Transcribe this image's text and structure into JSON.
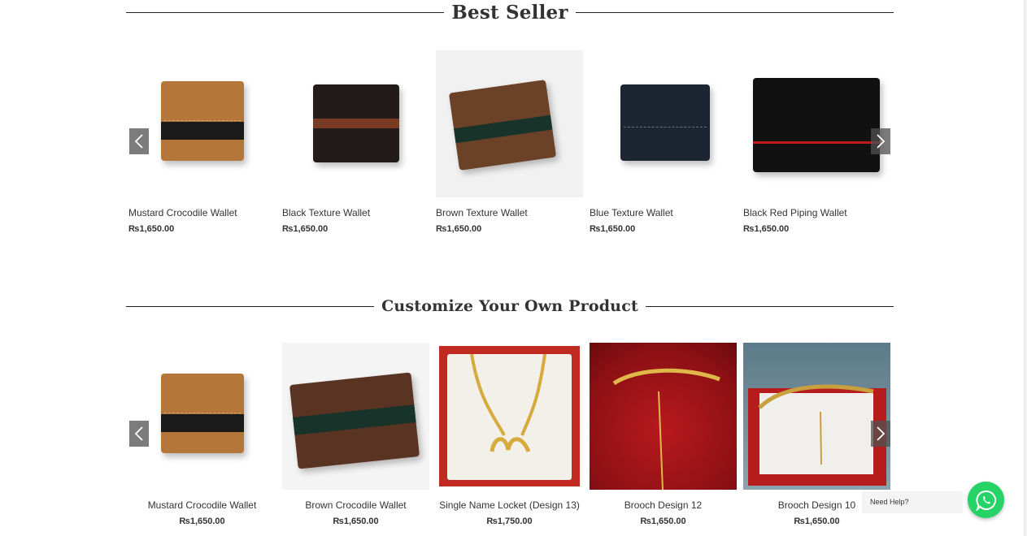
{
  "best_seller": {
    "title": "Best Seller",
    "products": [
      {
        "name": "Mustard Crocodile Wallet",
        "price": "₨1,650.00"
      },
      {
        "name": "Black Texture Wallet",
        "price": "₨1,650.00"
      },
      {
        "name": "Brown Texture Wallet",
        "price": "₨1,650.00"
      },
      {
        "name": "Blue Texture Wallet",
        "price": "₨1,650.00"
      },
      {
        "name": "Black Red Piping Wallet",
        "price": "₨1,650.00"
      }
    ]
  },
  "customize": {
    "title": "Customize Your Own Product",
    "products": [
      {
        "name": "Mustard Crocodile Wallet",
        "price": "₨1,650.00"
      },
      {
        "name": "Brown Crocodile Wallet",
        "price": "₨1,650.00"
      },
      {
        "name": "Single Name Locket (Design 13)",
        "price": "₨1,750.00"
      },
      {
        "name": "Brooch Design 12",
        "price": "₨1,650.00"
      },
      {
        "name": "Brooch Design 10",
        "price": "₨1,650.00"
      }
    ]
  },
  "icons": {
    "prev": "chevron-left-icon",
    "next": "chevron-right-icon",
    "whatsapp": "whatsapp-icon"
  },
  "whatsapp": {
    "label": "Need Help?"
  },
  "colors": {
    "whatsapp_green": "#25d366",
    "mustard": "#b5763a",
    "black": "#1a1a1a",
    "brown": "#6b4128",
    "navy": "#1d2533",
    "red_velvet": "#a8151a"
  }
}
